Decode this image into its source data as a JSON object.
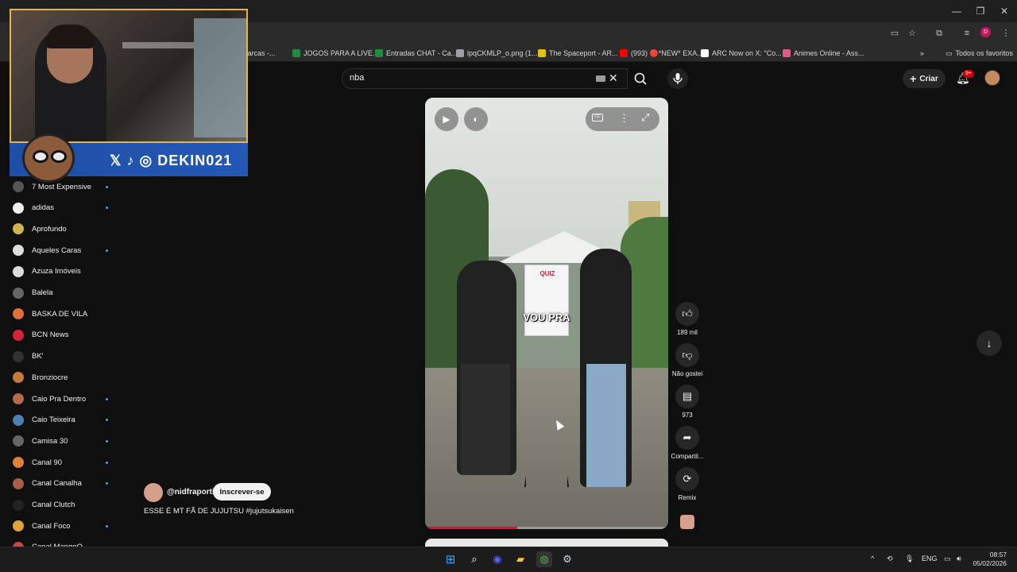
{
  "browser": {
    "bookmarks": [
      {
        "label": "Marcas -...",
        "icon": "bookmark-icon",
        "color": "#9aa0a6"
      },
      {
        "label": "JOGOS PARA A LIVE...",
        "icon": "sheets-icon",
        "color": "#1e8e3e"
      },
      {
        "label": "Entradas CHAT - Ca...",
        "icon": "sheets-icon",
        "color": "#1e8e3e"
      },
      {
        "label": "lpqCKMLP_o.png (1...",
        "icon": "globe-icon",
        "color": "#9aa0a6"
      },
      {
        "label": "The Spaceport - AR...",
        "icon": "spaceport-icon",
        "color": "#e5c100"
      },
      {
        "label": "(993) 🔴*NEW* EXA...",
        "icon": "youtube-icon",
        "color": "#ff0000"
      },
      {
        "label": "ARC Now on X: \"Co...",
        "icon": "x-icon",
        "color": "#ffffff"
      },
      {
        "label": "Animes Online - Ass...",
        "icon": "anime-icon",
        "color": "#e05a8a"
      }
    ],
    "bookmarks_all_label": "Todos os favoritos",
    "profile_initial": "D"
  },
  "header": {
    "search_value": "nba",
    "create_label": "Criar",
    "notifications_badge": "9+"
  },
  "overlay": {
    "handle": "DEKIN021"
  },
  "sidebar": {
    "items": [
      {
        "label": "7 Most Expensive",
        "new": true,
        "color": "#555"
      },
      {
        "label": "adidas",
        "new": true,
        "color": "#eee"
      },
      {
        "label": "Aprofundo",
        "new": false,
        "color": "#d2b24c"
      },
      {
        "label": "Aqueles Caras",
        "new": true,
        "color": "#ddd"
      },
      {
        "label": "Azuza Imóveis",
        "new": false,
        "color": "#ddd"
      },
      {
        "label": "Balela",
        "new": false,
        "color": "#666"
      },
      {
        "label": "BASKA DE VILA",
        "new": false,
        "color": "#e0703a"
      },
      {
        "label": "BCN News",
        "new": false,
        "color": "#d7243b"
      },
      {
        "label": "BK'",
        "new": false,
        "color": "#333"
      },
      {
        "label": "Bronziocre",
        "new": false,
        "color": "#c47a3f"
      },
      {
        "label": "Caio Pra Dentro",
        "new": true,
        "color": "#b36a4d"
      },
      {
        "label": "Caio Teixeira",
        "new": true,
        "color": "#4d7fb3"
      },
      {
        "label": "Camisa 30",
        "new": true,
        "color": "#666"
      },
      {
        "label": "Canal 90",
        "new": true,
        "color": "#e0813a"
      },
      {
        "label": "Canal Canalha",
        "new": true,
        "color": "#a85d4b"
      },
      {
        "label": "Canal Clutch",
        "new": false,
        "color": "#222"
      },
      {
        "label": "Canal Foco",
        "new": true,
        "color": "#e0a33a"
      },
      {
        "label": "Canal MangoO",
        "new": false,
        "color": "#c44"
      }
    ]
  },
  "short": {
    "caption": "VOU PRA",
    "board_title": "QUIZ",
    "progress": 0.38,
    "channel": "@nidfraporti",
    "subscribe_label": "Inscrever-se",
    "description": "ESSE É MT FÃ DE JUJUTSU #jujutsukaisen"
  },
  "actions": {
    "likes": "189 mil",
    "dislike_label": "Não gostei",
    "comments": "973",
    "share_label": "Compartil...",
    "remix_label": "Remix"
  },
  "taskbar": {
    "lang": "ENG",
    "time": "08:57",
    "date": "05/02/2026"
  },
  "colors": {
    "accent_red": "#ff0033",
    "new_dot": "#3ea6ff",
    "overlay_border": "#e7b44a",
    "overlay_bar": "#2457b6"
  }
}
